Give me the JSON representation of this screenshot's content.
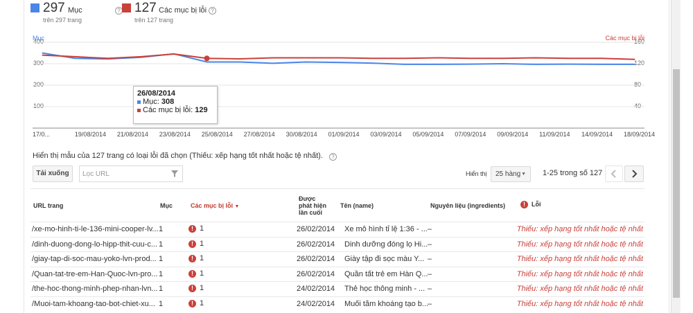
{
  "stats": {
    "items": {
      "value": "297",
      "label": "Mục",
      "sub": "trên 297 trang",
      "color": "#4a86e8"
    },
    "errors": {
      "value": "127",
      "label": "Các mục bị lỗi",
      "sub": "trên 127 trang",
      "color": "#c9413b"
    }
  },
  "chart_data": {
    "type": "line",
    "left_axis_title": "Mục",
    "right_axis_title": "Các mục bị lỗi",
    "left_ticks": [
      "400",
      "300",
      "200",
      "100"
    ],
    "right_ticks": [
      "160",
      "120",
      "80",
      "40"
    ],
    "left_ylim": [
      0,
      400
    ],
    "right_ylim": [
      0,
      160
    ],
    "x_tick_labels": [
      "17/0...",
      "19/08/2014",
      "21/08/2014",
      "23/08/2014",
      "25/08/2014",
      "27/08/2014",
      "30/08/2014",
      "01/09/2014",
      "03/09/2014",
      "05/09/2014",
      "07/09/2014",
      "09/09/2014",
      "11/09/2014",
      "14/09/2014",
      "18/09/2014"
    ],
    "series": [
      {
        "name": "Mục",
        "color": "#4a86e8",
        "values": [
          350,
          325,
          322,
          330,
          346,
          308,
          308,
          302,
          308,
          306,
          303,
          297,
          297,
          298,
          300,
          297,
          298,
          297,
          297
        ]
      },
      {
        "name": "Các mục bị lỗi",
        "color": "#c9413b",
        "values": [
          136,
          133,
          130,
          133,
          138,
          130,
          129,
          131,
          131,
          131,
          130,
          130,
          131,
          130,
          130,
          131,
          130,
          130,
          128
        ]
      }
    ],
    "tooltip": {
      "date": "26/08/2014",
      "items_label": "Mục:",
      "items_value": "308",
      "errors_label": "Các mục bị lỗi:",
      "errors_value": "129"
    }
  },
  "sample_text": "Hiển thị mẫu của 127 trang có loại lỗi đã chọn (Thiếu: xếp hạng tốt nhất hoặc tệ nhất).",
  "toolbar": {
    "download": "Tải xuống",
    "filter_placeholder": "Lọc URL",
    "show_label": "Hiển thị",
    "rows_select": "25 hàng",
    "range": "1-25 trong số 127"
  },
  "table": {
    "headers": {
      "url": "URL trang",
      "items": "Mục",
      "errors": "Các mục bị lỗi",
      "published": "Được phát hiện lần cuối",
      "name": "Tên (name)",
      "ingredients": "Nguyên liệu (ingredients)",
      "error": "Lỗi"
    },
    "rows": [
      {
        "url": "/xe-mo-hinh-ti-le-136-mini-cooper-lv...",
        "items": "1",
        "errors": "1",
        "date": "26/02/2014",
        "name": "Xe mô hình tỉ lệ 1:36 - ...",
        "ing": "–",
        "err": "Thiếu: xếp hạng tốt nhất hoặc tệ nhất"
      },
      {
        "url": "/dinh-duong-dong-lo-hipp-thit-cuu-c...",
        "items": "1",
        "errors": "1",
        "date": "26/02/2014",
        "name": "Dinh dưỡng đóng lọ Hi...",
        "ing": "–",
        "err": "Thiếu: xếp hạng tốt nhất hoặc tệ nhất"
      },
      {
        "url": "/giay-tap-di-soc-mau-yoko-lvn-prod...",
        "items": "1",
        "errors": "1",
        "date": "26/02/2014",
        "name": "Giày tập đi sọc màu Y...",
        "ing": "–",
        "err": "Thiếu: xếp hạng tốt nhất hoặc tệ nhất"
      },
      {
        "url": "/Quan-tat-tre-em-Han-Quoc-lvn-pro...",
        "items": "1",
        "errors": "1",
        "date": "26/02/2014",
        "name": "Quần tất trẻ em Hàn Q...",
        "ing": "–",
        "err": "Thiếu: xếp hạng tốt nhất hoặc tệ nhất"
      },
      {
        "url": "/the-hoc-thong-minh-phep-nhan-lvn...",
        "items": "1",
        "errors": "1",
        "date": "24/02/2014",
        "name": "Thẻ học thông minh - ...",
        "ing": "–",
        "err": "Thiếu: xếp hạng tốt nhất hoặc tệ nhất"
      },
      {
        "url": "/Muoi-tam-khoang-tao-bot-chiet-xu...",
        "items": "1",
        "errors": "1",
        "date": "24/02/2014",
        "name": "Muối tắm khoáng tạo b...",
        "ing": "–",
        "err": "Thiếu: xếp hạng tốt nhất hoặc tệ nhất"
      }
    ]
  }
}
